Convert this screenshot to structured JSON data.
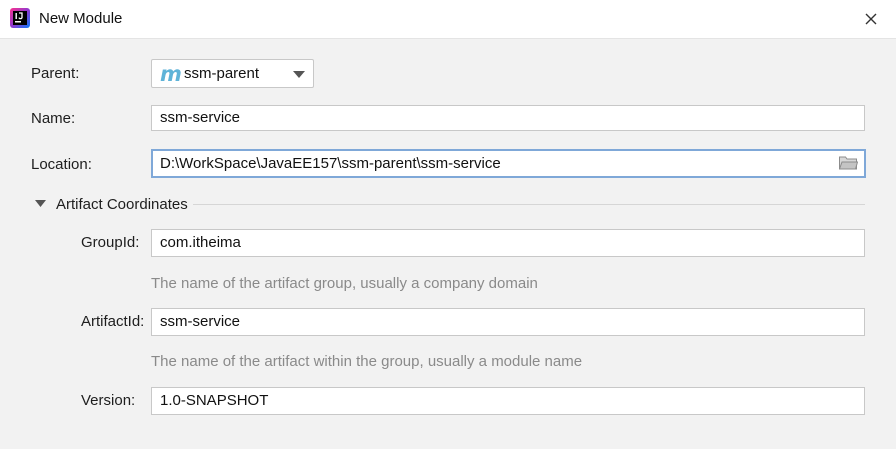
{
  "window": {
    "title": "New Module"
  },
  "form": {
    "parent_label": "Parent:",
    "parent_value": "ssm-parent",
    "parent_icon_glyph": "m",
    "name_label": "Name:",
    "name_value": "ssm-service",
    "location_label": "Location:",
    "location_value": "D:\\WorkSpace\\JavaEE157\\ssm-parent\\ssm-service"
  },
  "artifact": {
    "section_title": "Artifact Coordinates",
    "expanded": true,
    "groupid_label": "GroupId:",
    "groupid_value": "com.itheima",
    "groupid_hint": "The name of the artifact group, usually a company domain",
    "artifactid_label": "ArtifactId:",
    "artifactid_value": "ssm-service",
    "artifactid_hint": "The name of the artifact within the group, usually a module name",
    "version_label": "Version:",
    "version_value": "1.0-SNAPSHOT"
  },
  "icons": {
    "app": "intellij-idea-icon",
    "close": "close-icon",
    "parent_module": "maven-module-icon",
    "dropdown": "chevron-down-icon",
    "browse": "folder-icon",
    "section_toggle": "triangle-down-icon"
  },
  "colors": {
    "focus_border": "#7fa8d8",
    "maven_icon": "#5fb3d8",
    "hint_text": "#8a8a8a"
  }
}
